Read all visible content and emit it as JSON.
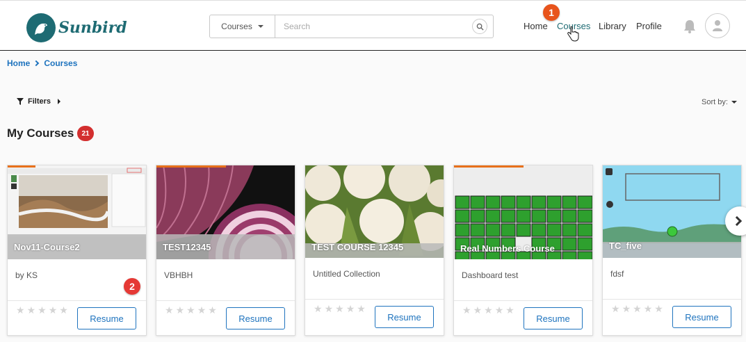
{
  "app": {
    "name": "Sunbird"
  },
  "search": {
    "category": "Courses",
    "placeholder": "Search"
  },
  "nav": {
    "home": "Home",
    "courses": "Courses",
    "library": "Library",
    "profile": "Profile"
  },
  "breadcrumb": {
    "home": "Home",
    "current": "Courses"
  },
  "toolbar": {
    "filters": "Filters",
    "sort_by": "Sort by:"
  },
  "section": {
    "title": "My Courses",
    "count": "21"
  },
  "callouts": {
    "one": "1",
    "two": "2"
  },
  "cards": [
    {
      "title": "Nov11-Course2",
      "subtitle": "by KS",
      "action": "Resume",
      "progress": 0.2
    },
    {
      "title": "TEST12345",
      "subtitle": "VBHBH",
      "action": "Resume",
      "progress": 0.5
    },
    {
      "title": "TEST COURSE 12345",
      "subtitle": "Untitled Collection",
      "action": "Resume",
      "progress": 0
    },
    {
      "title": "Real Numbers Course",
      "subtitle": "Dashboard test",
      "action": "Resume",
      "progress": 0.5
    },
    {
      "title": "TC_five",
      "subtitle": "fdsf",
      "action": "Resume",
      "progress": 0
    }
  ],
  "colors": {
    "brand": "#1e6b73",
    "link": "#1e73be",
    "badge": "#d32f2f",
    "progress": "#e8701a"
  },
  "icons": {
    "search": "search-icon",
    "bell": "bell-icon",
    "avatar": "user-icon",
    "filter": "filter-icon",
    "next": "chevron-right-icon"
  }
}
